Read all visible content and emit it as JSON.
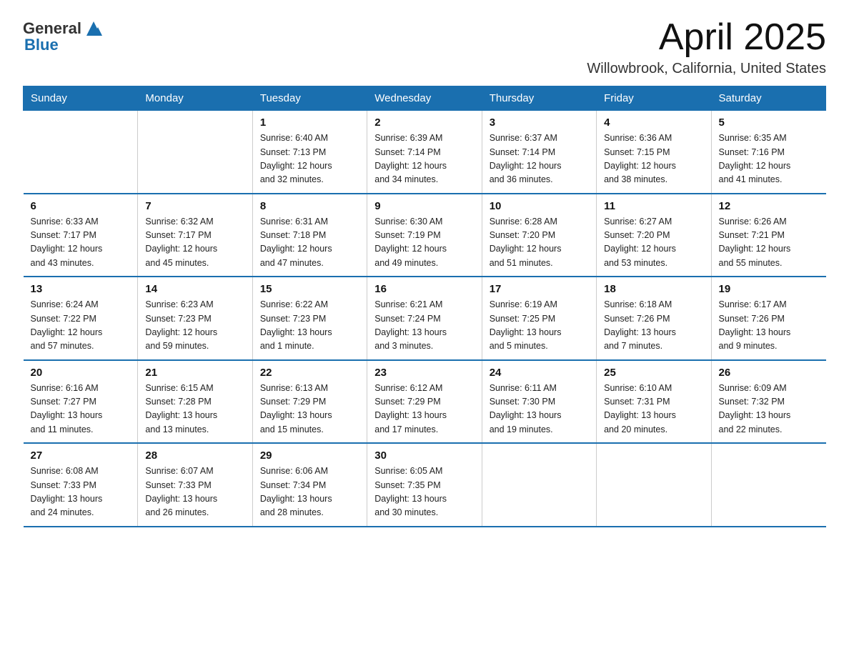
{
  "header": {
    "logo_general": "General",
    "logo_blue": "Blue",
    "month_title": "April 2025",
    "location": "Willowbrook, California, United States"
  },
  "days_of_week": [
    "Sunday",
    "Monday",
    "Tuesday",
    "Wednesday",
    "Thursday",
    "Friday",
    "Saturday"
  ],
  "weeks": [
    [
      {
        "day": "",
        "info": ""
      },
      {
        "day": "",
        "info": ""
      },
      {
        "day": "1",
        "info": "Sunrise: 6:40 AM\nSunset: 7:13 PM\nDaylight: 12 hours\nand 32 minutes."
      },
      {
        "day": "2",
        "info": "Sunrise: 6:39 AM\nSunset: 7:14 PM\nDaylight: 12 hours\nand 34 minutes."
      },
      {
        "day": "3",
        "info": "Sunrise: 6:37 AM\nSunset: 7:14 PM\nDaylight: 12 hours\nand 36 minutes."
      },
      {
        "day": "4",
        "info": "Sunrise: 6:36 AM\nSunset: 7:15 PM\nDaylight: 12 hours\nand 38 minutes."
      },
      {
        "day": "5",
        "info": "Sunrise: 6:35 AM\nSunset: 7:16 PM\nDaylight: 12 hours\nand 41 minutes."
      }
    ],
    [
      {
        "day": "6",
        "info": "Sunrise: 6:33 AM\nSunset: 7:17 PM\nDaylight: 12 hours\nand 43 minutes."
      },
      {
        "day": "7",
        "info": "Sunrise: 6:32 AM\nSunset: 7:17 PM\nDaylight: 12 hours\nand 45 minutes."
      },
      {
        "day": "8",
        "info": "Sunrise: 6:31 AM\nSunset: 7:18 PM\nDaylight: 12 hours\nand 47 minutes."
      },
      {
        "day": "9",
        "info": "Sunrise: 6:30 AM\nSunset: 7:19 PM\nDaylight: 12 hours\nand 49 minutes."
      },
      {
        "day": "10",
        "info": "Sunrise: 6:28 AM\nSunset: 7:20 PM\nDaylight: 12 hours\nand 51 minutes."
      },
      {
        "day": "11",
        "info": "Sunrise: 6:27 AM\nSunset: 7:20 PM\nDaylight: 12 hours\nand 53 minutes."
      },
      {
        "day": "12",
        "info": "Sunrise: 6:26 AM\nSunset: 7:21 PM\nDaylight: 12 hours\nand 55 minutes."
      }
    ],
    [
      {
        "day": "13",
        "info": "Sunrise: 6:24 AM\nSunset: 7:22 PM\nDaylight: 12 hours\nand 57 minutes."
      },
      {
        "day": "14",
        "info": "Sunrise: 6:23 AM\nSunset: 7:23 PM\nDaylight: 12 hours\nand 59 minutes."
      },
      {
        "day": "15",
        "info": "Sunrise: 6:22 AM\nSunset: 7:23 PM\nDaylight: 13 hours\nand 1 minute."
      },
      {
        "day": "16",
        "info": "Sunrise: 6:21 AM\nSunset: 7:24 PM\nDaylight: 13 hours\nand 3 minutes."
      },
      {
        "day": "17",
        "info": "Sunrise: 6:19 AM\nSunset: 7:25 PM\nDaylight: 13 hours\nand 5 minutes."
      },
      {
        "day": "18",
        "info": "Sunrise: 6:18 AM\nSunset: 7:26 PM\nDaylight: 13 hours\nand 7 minutes."
      },
      {
        "day": "19",
        "info": "Sunrise: 6:17 AM\nSunset: 7:26 PM\nDaylight: 13 hours\nand 9 minutes."
      }
    ],
    [
      {
        "day": "20",
        "info": "Sunrise: 6:16 AM\nSunset: 7:27 PM\nDaylight: 13 hours\nand 11 minutes."
      },
      {
        "day": "21",
        "info": "Sunrise: 6:15 AM\nSunset: 7:28 PM\nDaylight: 13 hours\nand 13 minutes."
      },
      {
        "day": "22",
        "info": "Sunrise: 6:13 AM\nSunset: 7:29 PM\nDaylight: 13 hours\nand 15 minutes."
      },
      {
        "day": "23",
        "info": "Sunrise: 6:12 AM\nSunset: 7:29 PM\nDaylight: 13 hours\nand 17 minutes."
      },
      {
        "day": "24",
        "info": "Sunrise: 6:11 AM\nSunset: 7:30 PM\nDaylight: 13 hours\nand 19 minutes."
      },
      {
        "day": "25",
        "info": "Sunrise: 6:10 AM\nSunset: 7:31 PM\nDaylight: 13 hours\nand 20 minutes."
      },
      {
        "day": "26",
        "info": "Sunrise: 6:09 AM\nSunset: 7:32 PM\nDaylight: 13 hours\nand 22 minutes."
      }
    ],
    [
      {
        "day": "27",
        "info": "Sunrise: 6:08 AM\nSunset: 7:33 PM\nDaylight: 13 hours\nand 24 minutes."
      },
      {
        "day": "28",
        "info": "Sunrise: 6:07 AM\nSunset: 7:33 PM\nDaylight: 13 hours\nand 26 minutes."
      },
      {
        "day": "29",
        "info": "Sunrise: 6:06 AM\nSunset: 7:34 PM\nDaylight: 13 hours\nand 28 minutes."
      },
      {
        "day": "30",
        "info": "Sunrise: 6:05 AM\nSunset: 7:35 PM\nDaylight: 13 hours\nand 30 minutes."
      },
      {
        "day": "",
        "info": ""
      },
      {
        "day": "",
        "info": ""
      },
      {
        "day": "",
        "info": ""
      }
    ]
  ]
}
